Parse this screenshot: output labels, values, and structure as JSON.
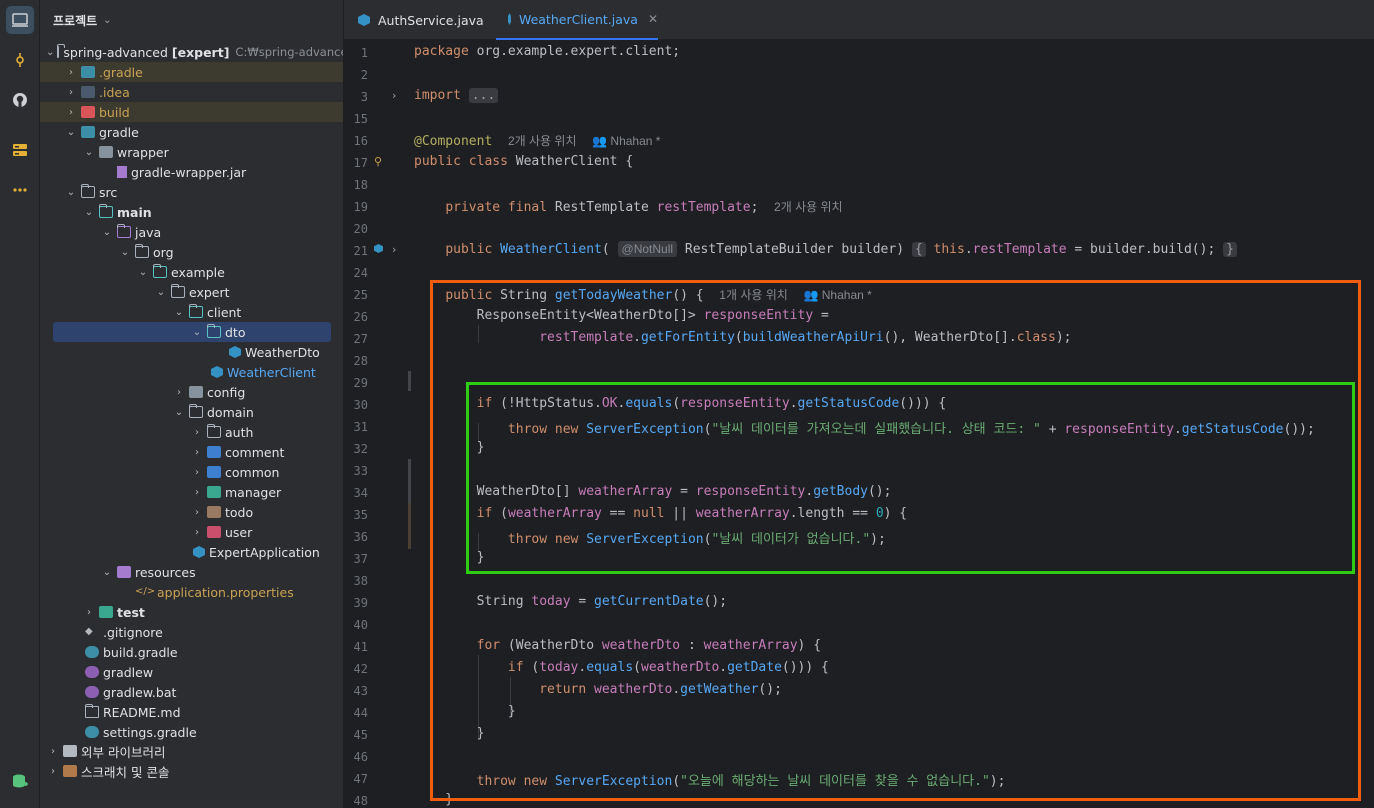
{
  "project_panel": {
    "title": "프로젝트",
    "root_name": "spring-advanced",
    "root_module": "[expert]",
    "root_path": "C:₩spring-advanced",
    "items": [
      {
        "label": ".gradle"
      },
      {
        "label": ".idea"
      },
      {
        "label": "build"
      },
      {
        "label": "gradle"
      },
      {
        "label": "wrapper"
      },
      {
        "label": "gradle-wrapper.jar"
      },
      {
        "label": "src"
      },
      {
        "label": "main"
      },
      {
        "label": "java"
      },
      {
        "label": "org"
      },
      {
        "label": "example"
      },
      {
        "label": "expert"
      },
      {
        "label": "client"
      },
      {
        "label": "dto"
      },
      {
        "label": "WeatherDto"
      },
      {
        "label": "WeatherClient"
      },
      {
        "label": "config"
      },
      {
        "label": "domain"
      },
      {
        "label": "auth"
      },
      {
        "label": "comment"
      },
      {
        "label": "common"
      },
      {
        "label": "manager"
      },
      {
        "label": "todo"
      },
      {
        "label": "user"
      },
      {
        "label": "ExpertApplication"
      },
      {
        "label": "resources"
      },
      {
        "label": "application.properties"
      },
      {
        "label": "test"
      },
      {
        "label": ".gitignore"
      },
      {
        "label": "build.gradle"
      },
      {
        "label": "gradlew"
      },
      {
        "label": "gradlew.bat"
      },
      {
        "label": "README.md"
      },
      {
        "label": "settings.gradle"
      },
      {
        "label": "외부 라이브러리"
      },
      {
        "label": "스크래치 및 콘솔"
      }
    ]
  },
  "tabs": [
    {
      "label": "AuthService.java"
    },
    {
      "label": "WeatherClient.java"
    }
  ],
  "editor": {
    "line_numbers": [
      "1",
      "2",
      "3",
      "15",
      "16",
      "17",
      "18",
      "19",
      "20",
      "21",
      "24",
      "25",
      "26",
      "27",
      "28",
      "29",
      "30",
      "31",
      "32",
      "33",
      "34",
      "35",
      "36",
      "37",
      "38",
      "39",
      "40",
      "41",
      "42",
      "43",
      "44",
      "45",
      "46",
      "47",
      "48"
    ],
    "hints": {
      "usages_2": "2개 사용 위치",
      "usages_1": "1개 사용 위치",
      "author": "Nhahan *",
      "notnull": "@NotNull",
      "fold": "..."
    },
    "strings": {
      "s1": "\"날씨 데이터를 가져오는데 실패했습니다. 상태 코드: \"",
      "s2": "\"날씨 데이터가 없습니다.\"",
      "s3": "\"오늘에 해당하는 날씨 데이터를 찾을 수 없습니다.\""
    }
  },
  "colors": {
    "highlight_outer": "#f25c0e",
    "highlight_inner": "#2ecc12"
  }
}
